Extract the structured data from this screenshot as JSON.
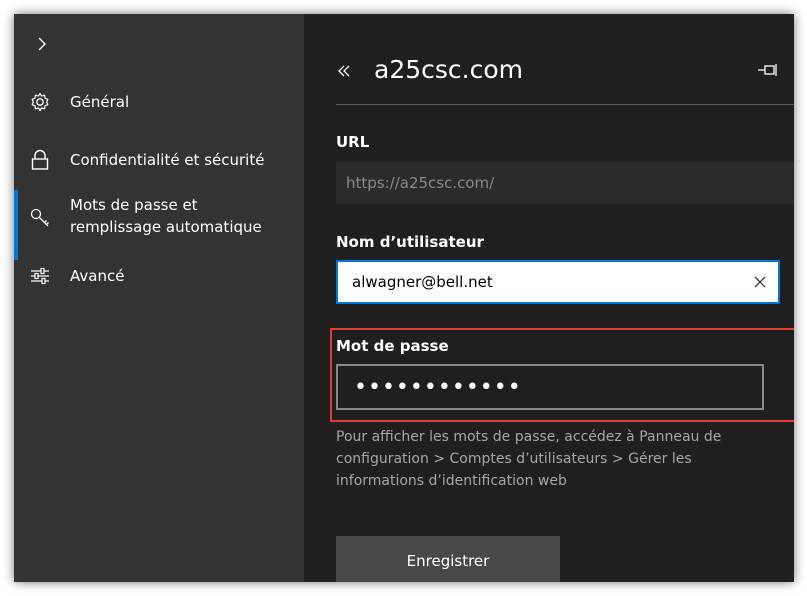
{
  "sidebar": {
    "items": [
      {
        "label": "Général",
        "icon": "gear-icon"
      },
      {
        "label": "Confidentialité et sécurité",
        "icon": "lock-icon"
      },
      {
        "label": "Mots de passe et\nremplissage automatique",
        "icon": "key-icon",
        "active": true
      },
      {
        "label": "Avancé",
        "icon": "sliders-icon"
      }
    ]
  },
  "panel": {
    "title": "a25csc.com",
    "url_label": "URL",
    "url_value": "https://a25csc.com/",
    "username_label": "Nom d’utilisateur",
    "username_value": "alwagner@bell.net",
    "password_label": "Mot de passe",
    "password_value": "••••••••••••",
    "hint": "Pour afficher les mots de passe, accédez à Panneau de configuration > Comptes d’utilisateurs > Gérer les informations d’identification web",
    "save_label": "Enregistrer"
  },
  "colors": {
    "accent": "#0078d7",
    "highlight": "#e53935",
    "sidebar_bg": "#333333",
    "panel_bg": "#1f1f1f"
  }
}
